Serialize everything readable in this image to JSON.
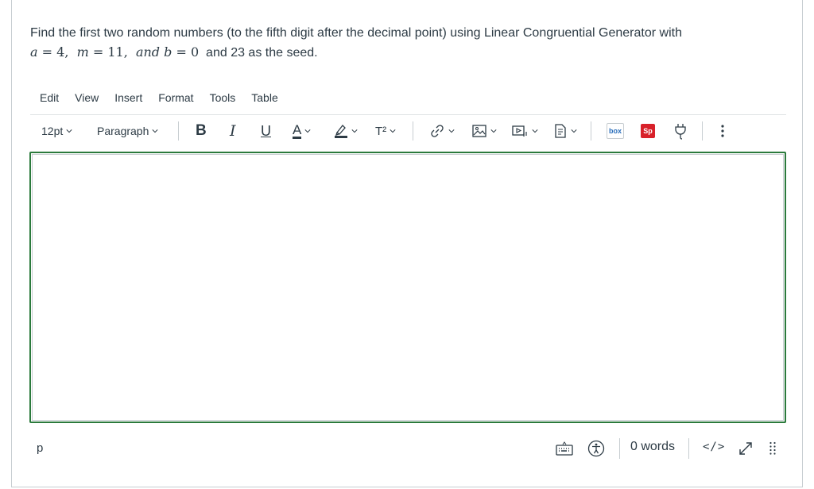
{
  "question": {
    "line1": "Find the first two random numbers (to the fifth digit after the decimal point) using Linear Congruential Generator with",
    "line2_math": {
      "a_var": "a",
      "eq": " = ",
      "a_val": "4",
      "m_var": "m",
      "m_val": "11",
      "and_word": "and",
      "b_var": "b",
      "b_val": "0",
      "tail": "and 23 as the seed."
    }
  },
  "menubar": {
    "items": [
      "Edit",
      "View",
      "Insert",
      "Format",
      "Tools",
      "Table"
    ]
  },
  "toolbar": {
    "font_size": "12pt",
    "block_format": "Paragraph",
    "bold_glyph": "B",
    "italic_glyph": "I",
    "underline_glyph": "U",
    "text_color_glyph": "A",
    "superscript_glyph": "T²",
    "box_label": "box",
    "sp_label": "Sp",
    "colors": {
      "text_color_bar": "#2d3b45",
      "sp_badge": "#d8212a",
      "box_blue": "#2a6ebb"
    }
  },
  "editor": {
    "content": "",
    "focus_border_color": "#2b7a3c"
  },
  "statusbar": {
    "path": "p",
    "word_count": "0 words",
    "html_toggle": "</>"
  }
}
